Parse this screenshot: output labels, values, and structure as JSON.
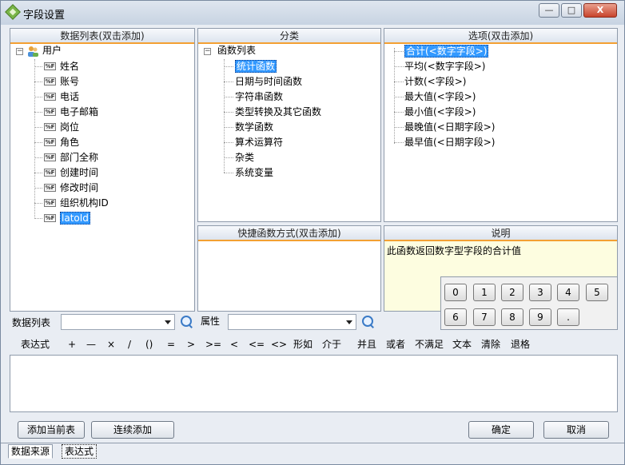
{
  "window": {
    "title": "字段设置"
  },
  "panels": {
    "datalist": {
      "header": "数据列表(双击添加)",
      "root": "用户",
      "fields": [
        "姓名",
        "账号",
        "电话",
        "电子邮箱",
        "岗位",
        "角色",
        "部门全称",
        "创建时间",
        "修改时间",
        "组织机构ID",
        "latoId"
      ],
      "field_icon_text": "%F"
    },
    "category": {
      "header": "分类",
      "root": "函数列表",
      "items": [
        "统计函数",
        "日期与时间函数",
        "字符串函数",
        "类型转换及其它函数",
        "数学函数",
        "算术运算符",
        "杂类",
        "系统变量"
      ]
    },
    "options": {
      "header": "选项(双击添加)",
      "items": [
        "合计(<数字字段>)",
        "平均(<数字字段>)",
        "计数(<字段>)",
        "最大值(<字段>)",
        "最小值(<字段>)",
        "最晚值(<日期字段>)",
        "最早值(<日期字段>)"
      ]
    },
    "shortcut": {
      "header": "快捷函数方式(双击添加)"
    },
    "description": {
      "header": "说明",
      "text": "此函数返回数字型字段的合计值"
    }
  },
  "filters": {
    "datalist_label": "数据列表",
    "datalist_value": "",
    "property_label": "属性",
    "property_value": ""
  },
  "toolbar": {
    "label": "表达式",
    "operators": [
      "+",
      "—",
      "×",
      "/",
      "()",
      "=",
      ">",
      ">=",
      "<",
      "<=",
      "<>",
      "形如",
      "介于",
      "并且",
      "或者",
      "不满足",
      "文本",
      "清除",
      "退格"
    ]
  },
  "numpad": {
    "keys": [
      "0",
      "1",
      "2",
      "3",
      "4",
      "5",
      "6",
      "7",
      "8",
      "9",
      "."
    ]
  },
  "buttons": {
    "add_current": "添加当前表",
    "add_continuous": "连续添加",
    "ok": "确定",
    "cancel": "取消"
  },
  "tabs": [
    "数据来源",
    "表达式"
  ],
  "window_buttons": {
    "minimize": "—",
    "maximize": "□",
    "close": "X"
  }
}
